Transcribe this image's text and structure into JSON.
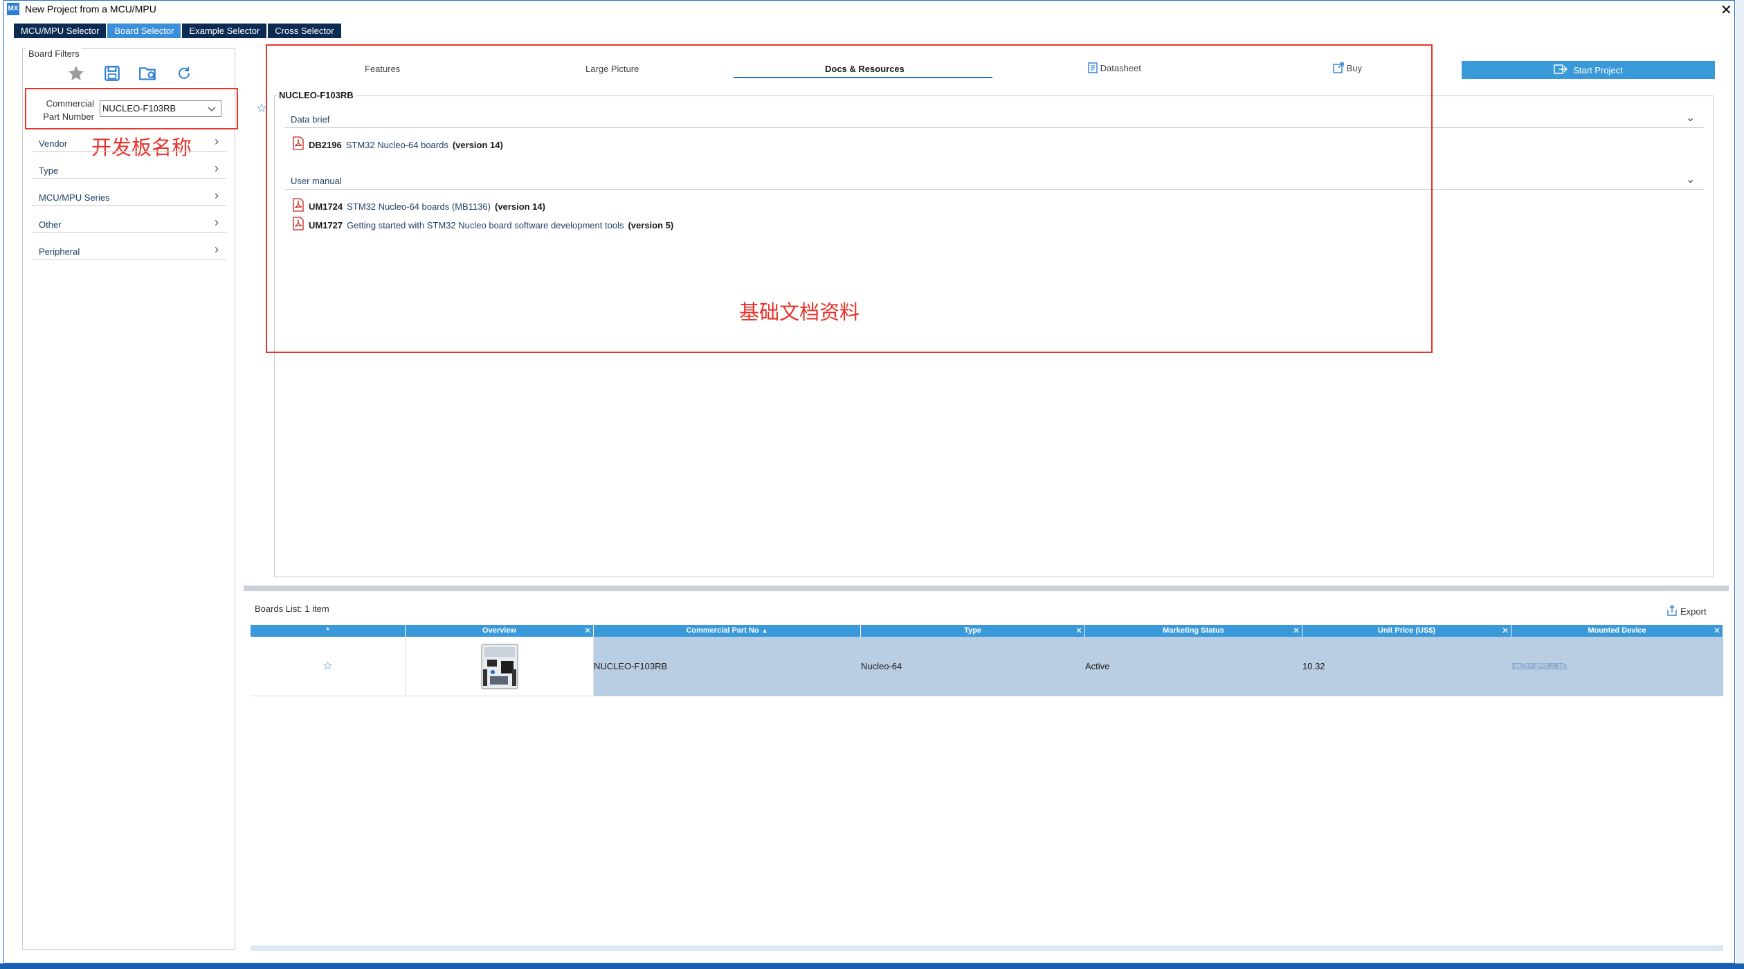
{
  "window": {
    "title": "New Project from a MCU/MPU",
    "app_icon": "MX",
    "close_label": "✕"
  },
  "selector_tabs": [
    {
      "label": "MCU/MPU Selector",
      "active": false
    },
    {
      "label": "Board Selector",
      "active": true
    },
    {
      "label": "Example Selector",
      "active": false
    },
    {
      "label": "Cross Selector",
      "active": false
    }
  ],
  "board_filters": {
    "legend": "Board Filters",
    "icons": [
      "star-icon",
      "save-icon",
      "load-filter-icon",
      "reset-icon"
    ],
    "cpn_label": "Commercial Part Number",
    "cpn_value": "NUCLEO-F103RB",
    "items": [
      "Vendor",
      "Type",
      "MCU/MPU Series",
      "Other",
      "Peripheral"
    ],
    "annotation": "开发板名称"
  },
  "detail_tabs": [
    {
      "label": "Features",
      "active": false
    },
    {
      "label": "Large Picture",
      "active": false
    },
    {
      "label": "Docs & Resources",
      "active": true
    },
    {
      "label": "Datasheet",
      "active": false,
      "icon": "datasheet-icon"
    },
    {
      "label": "Buy",
      "active": false,
      "icon": "external-link-icon"
    }
  ],
  "start_project_label": "Start Project",
  "resources": {
    "board_name": "NUCLEO-F103RB",
    "sections": [
      {
        "title": "Data brief",
        "docs": [
          {
            "code": "DB2196",
            "name": "STM32 Nucleo-64 boards",
            "version": "(version 14)"
          }
        ]
      },
      {
        "title": "User manual",
        "docs": [
          {
            "code": "UM1724",
            "name": "STM32 Nucleo-64 boards (MB1136)",
            "version": "(version 14)"
          },
          {
            "code": "UM1727",
            "name": "Getting started with STM32 Nucleo board software development tools",
            "version": "(version 5)"
          }
        ]
      }
    ],
    "annotation": "基础文档资料"
  },
  "boards_list": {
    "count_label": "Boards List: 1 item",
    "export_label": "Export",
    "columns": [
      "*",
      "Overview",
      "Commercial Part No",
      "Type",
      "Marketing Status",
      "Unit Price (US$)",
      "Mounted Device"
    ],
    "rows": [
      {
        "star": "☆",
        "part_no": "NUCLEO-F103RB",
        "type": "Nucleo-64",
        "status": "Active",
        "price": "10.32",
        "device": "STM32F103RBTx"
      }
    ]
  },
  "colors": {
    "accent": "#3a9ad9",
    "dark_tab": "#0b2b52",
    "annotation_red": "#e8322a",
    "row_selected": "#b9cde3"
  }
}
